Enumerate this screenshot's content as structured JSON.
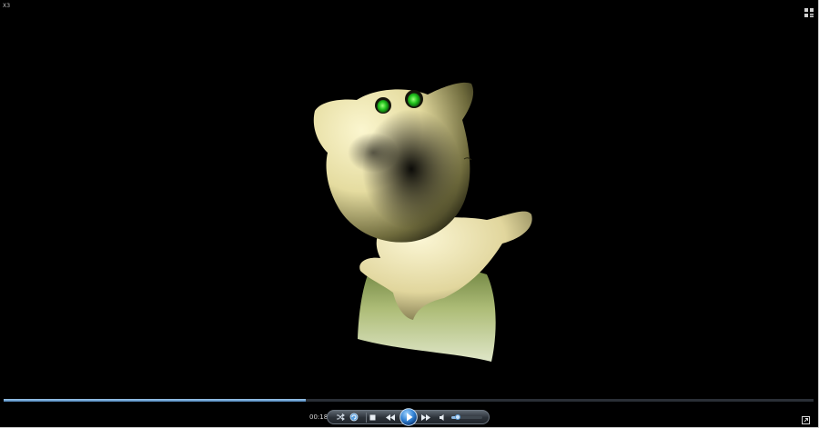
{
  "window": {
    "title": "X3"
  },
  "playback": {
    "elapsed_time": "00:18",
    "progress_fraction": 0.373,
    "volume_fraction": 0.2
  },
  "icons": {
    "switch_view": "switch-to-library-icon",
    "shuffle": "shuffle-icon",
    "repeat": "repeat-icon",
    "stop": "stop-icon",
    "previous": "previous-icon",
    "play": "play-icon",
    "next": "next-icon",
    "mute": "speaker-icon",
    "fullscreen": "fullscreen-icon"
  },
  "colors": {
    "background": "#000000",
    "seek_fill": "#7fb0df",
    "play_button": "#2f7fd1",
    "figure_body": "#e8e0a8",
    "eyes": "#22c51e"
  }
}
